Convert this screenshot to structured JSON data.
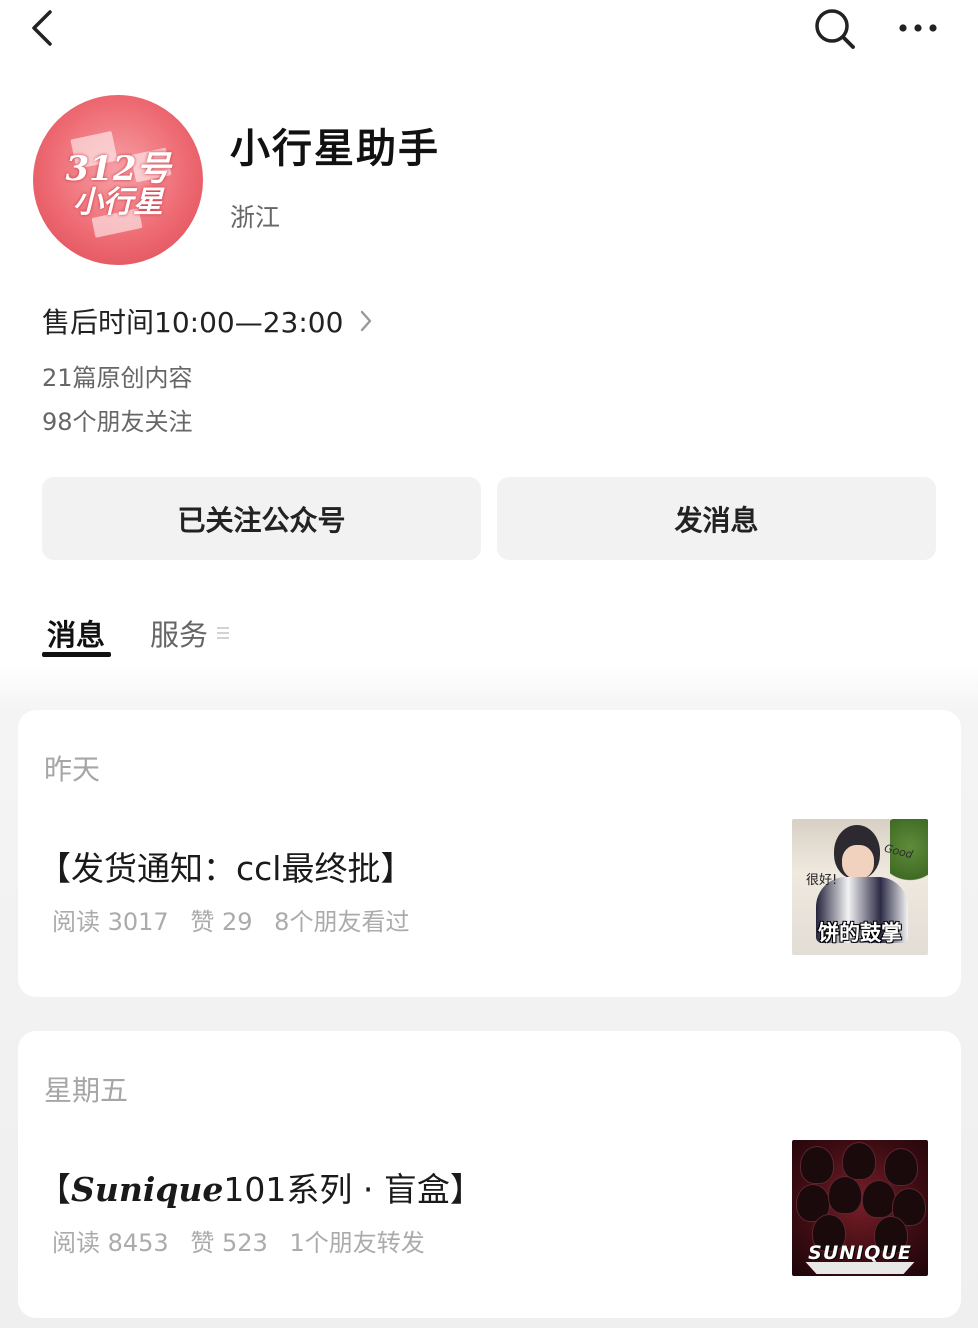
{
  "account": {
    "name": "小行星助手",
    "region": "浙江",
    "avatar_line1": "312号",
    "avatar_line2": "小行星",
    "service_hours": "售后时间10:00—23:00",
    "original_articles": "21篇原创内容",
    "followers": "98个朋友关注"
  },
  "actions": {
    "follow_label": "已关注公众号",
    "message_label": "发消息"
  },
  "tabs": [
    {
      "label": "消息",
      "active": true
    },
    {
      "label": "服务",
      "active": false
    }
  ],
  "icons": {
    "back": "chevron-left-icon",
    "search": "search-icon",
    "more": "more-horizontal-icon",
    "service_hours_chevron": "chevron-right-icon",
    "services_menu": "menu-lines-icon"
  },
  "feed": [
    {
      "date": "昨天",
      "articles": [
        {
          "title": "【发货通知：ccl最终批】",
          "reads": "阅读 3017",
          "likes": "赞 29",
          "social": "8个朋友看过",
          "thumbnail_caption": "饼的鼓掌",
          "thumbnail_bubble": "很好!",
          "thumbnail_good": "Good"
        }
      ]
    },
    {
      "date": "星期五",
      "articles": [
        {
          "title_open": "【",
          "title_brand": "Sunique",
          "title_rest": "101系列 · 盲盒】",
          "reads": "阅读 8453",
          "likes": "赞 523",
          "social": "1个朋友转发",
          "thumbnail_brand": "SUNIQUE"
        }
      ]
    }
  ],
  "colors": {
    "background": "#ffffff",
    "button_bg": "#f2f2f2",
    "feed_bg": "#efefef",
    "meta_text": "#ababab",
    "secondary_text": "#666666",
    "avatar_red": "#ee6a72"
  }
}
